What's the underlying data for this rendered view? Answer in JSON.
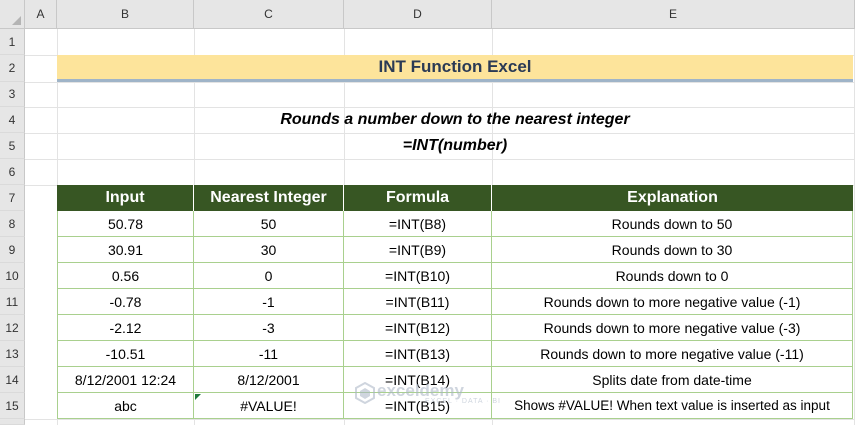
{
  "columns": [
    "A",
    "B",
    "C",
    "D",
    "E"
  ],
  "rows": [
    "1",
    "2",
    "3",
    "4",
    "5",
    "6",
    "7",
    "8",
    "9",
    "10",
    "11",
    "12",
    "13",
    "14",
    "15"
  ],
  "banner": {
    "title": "INT Function Excel"
  },
  "subtitle": {
    "line1": "Rounds a number down to the nearest integer",
    "line2": "=INT(number)"
  },
  "table": {
    "headers": [
      "Input",
      "Nearest Integer",
      "Formula",
      "Explanation"
    ],
    "rows": [
      [
        "50.78",
        "50",
        "=INT(B8)",
        "Rounds down to 50"
      ],
      [
        "30.91",
        "30",
        "=INT(B9)",
        "Rounds down to 30"
      ],
      [
        "0.56",
        "0",
        "=INT(B10)",
        "Rounds down to 0"
      ],
      [
        "-0.78",
        "-1",
        "=INT(B11)",
        "Rounds down to more negative value (-1)"
      ],
      [
        "-2.12",
        "-3",
        "=INT(B12)",
        "Rounds down to more negative value (-3)"
      ],
      [
        "-10.51",
        "-11",
        "=INT(B13)",
        "Rounds down to more negative value (-11)"
      ],
      [
        "8/12/2001 12:24",
        "8/12/2001",
        "=INT(B14)",
        "Splits date from date-time"
      ],
      [
        "abc",
        "#VALUE!",
        "=INT(B15)",
        "Shows #VALUE! When text value is inserted as input"
      ]
    ]
  },
  "watermark": {
    "name": "exceldemy",
    "tagline": "EXCEL · DATA · BI"
  },
  "colors": {
    "banner_bg": "#fde49b",
    "header_bg": "#375623",
    "border_green": "#a9d08e",
    "banner_text": "#2a3a55"
  }
}
